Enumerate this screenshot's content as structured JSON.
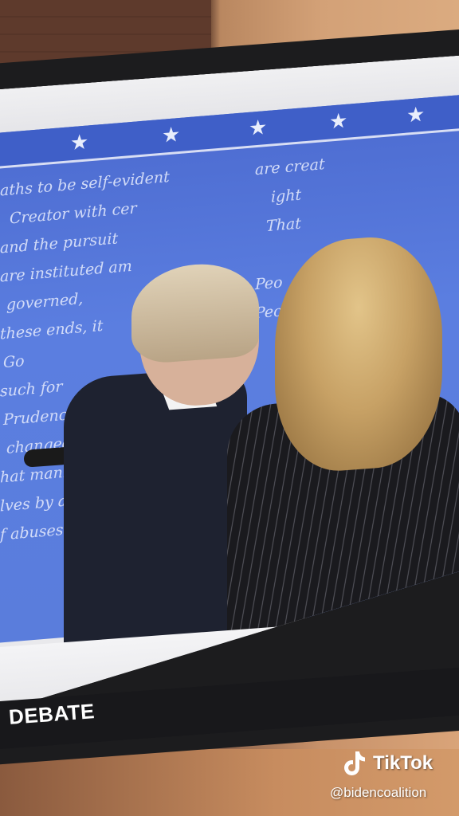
{
  "chyron": {
    "label": "DEBATE"
  },
  "watermark": {
    "brand": "TikTok",
    "handle": "@bidencoalition",
    "icon": "tiktok-note-icon"
  },
  "backdrop": {
    "lines": [
      "aths to be self-evident",
      "Creator with cer",
      "and the pursuit",
      "are instituted am",
      "governed,",
      "these ends, it",
      "Go",
      "such for",
      "Prudence",
      "changed",
      "hat mank",
      "lves by a",
      "f abuses a"
    ],
    "right_lines": [
      "are creat",
      "ight",
      "That",
      "Peo",
      "People c"
    ]
  },
  "colors": {
    "backdrop_blue": "#5a7ddc",
    "star_band": "#3f5fc8",
    "chyron_bg": "#18181b"
  }
}
